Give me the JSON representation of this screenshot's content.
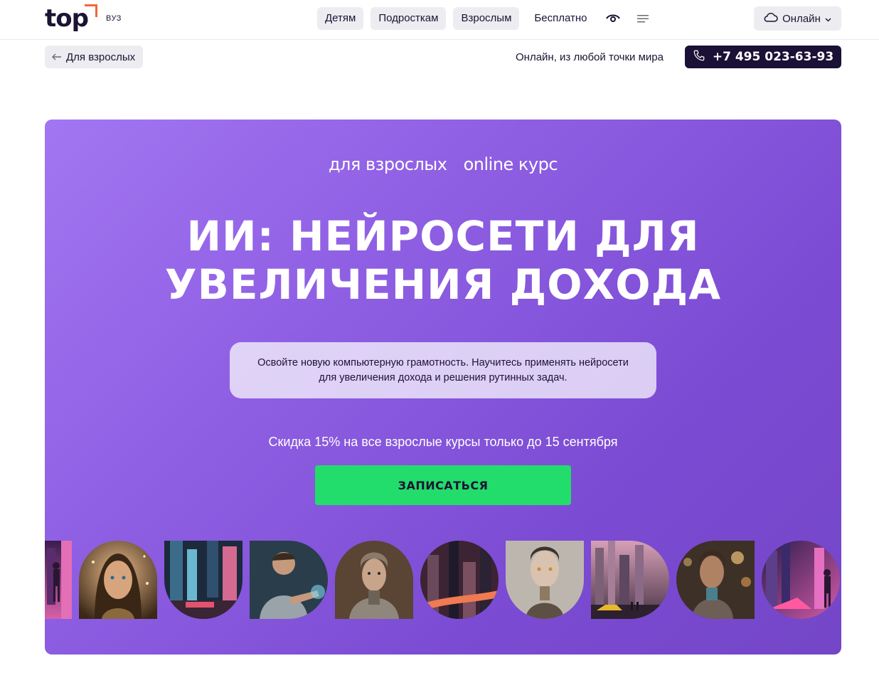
{
  "header": {
    "logo_text": "top",
    "logo_sub": "ВУЗ",
    "nav": [
      "Детям",
      "Подросткам",
      "Взрослым",
      "Бесплатно"
    ],
    "format_select": "Онлайн"
  },
  "subheader": {
    "back_label": "Для взрослых",
    "region_text": "Онлайн, из любой точки мира",
    "phone": "+7 495 023-63-93"
  },
  "hero": {
    "tag1": "для взрослых",
    "tag2": "online курс",
    "title_line1": "ИИ: НЕЙРОСЕТИ ДЛЯ",
    "title_line2": "УВЕЛИЧЕНИЯ ДОХОДА",
    "desc_line1": "Освойте новую компьютерную грамотность. Научитесь применять нейросети",
    "desc_line2": "для увеличения дохода и решения рутинных задач.",
    "promo": "Скидка 15% на все взрослые курсы только до 15 сентября",
    "cta": "ЗАПИСАТЬСЯ"
  },
  "colors": {
    "hero_gradient_start": "#a276f2",
    "hero_gradient_end": "#7446c7",
    "cta": "#22dc6b",
    "phone_bg": "#1b1036",
    "logo_accent": "#f2673a"
  },
  "gallery": [
    "neon-city-person",
    "ai-woman-portrait",
    "neon-city-street",
    "man-hologram-gesture",
    "robot-woman",
    "neon-cityscape",
    "android-face",
    "futuristic-city-car",
    "robot-woman-bokeh",
    "neon-city-walker"
  ]
}
